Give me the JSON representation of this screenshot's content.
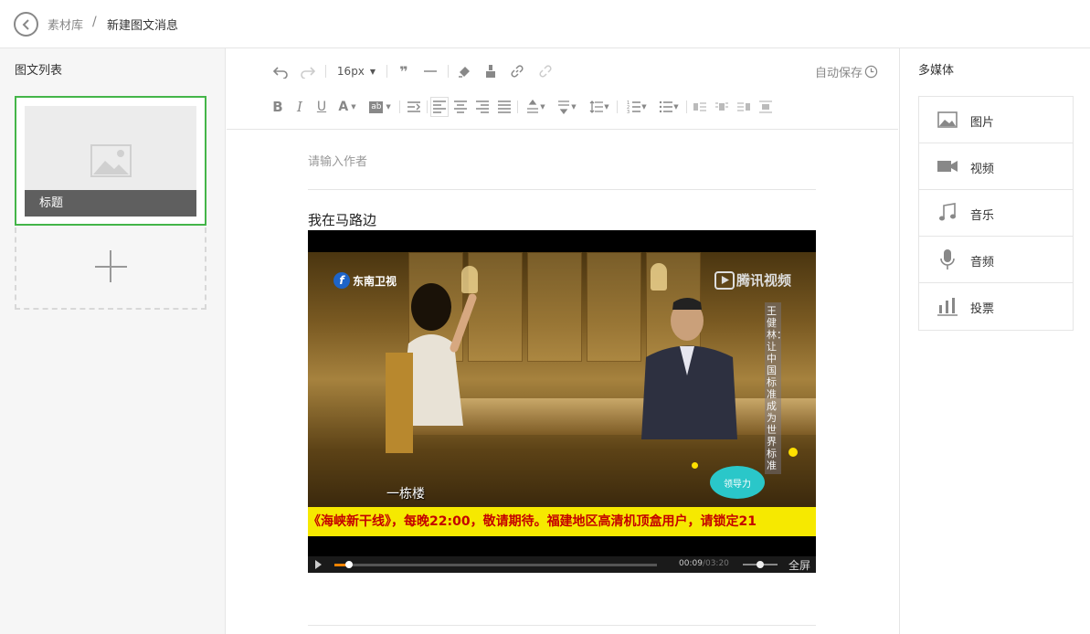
{
  "breadcrumb": {
    "parent": "素材库",
    "separator": "/",
    "current": "新建图文消息"
  },
  "left_panel": {
    "title": "图文列表",
    "articles": [
      {
        "title": "标题"
      }
    ]
  },
  "toolbar": {
    "font_size": "16px",
    "autosave_label": "自动保存"
  },
  "editor": {
    "author_placeholder": "请输入作者",
    "body_text": "我在马路边",
    "video": {
      "channel_logo": "东南卫视",
      "platform_logo": "腾讯视频",
      "side_caption": "王健林：让中国标准成为世界标准",
      "subtitle": "一栋楼",
      "show_logo": "领导力",
      "ticker": "《海峡新干线》，每晚22:00，敬请期待。福建地区高清机顶盒用户，请锁定21",
      "current_time": "00:09",
      "duration": "/03:20",
      "progress": 0.045,
      "volume": 0.5,
      "fullscreen_label": "全屏"
    }
  },
  "right_panel": {
    "title": "多媒体",
    "items": [
      {
        "label": "图片",
        "icon": "image-icon"
      },
      {
        "label": "视频",
        "icon": "video-icon"
      },
      {
        "label": "音乐",
        "icon": "music-icon"
      },
      {
        "label": "音频",
        "icon": "microphone-icon"
      },
      {
        "label": "投票",
        "icon": "poll-icon"
      }
    ]
  },
  "colors": {
    "accent_green": "#44b549",
    "ticker_yellow": "#f6e900",
    "progress_orange": "#f08300"
  }
}
